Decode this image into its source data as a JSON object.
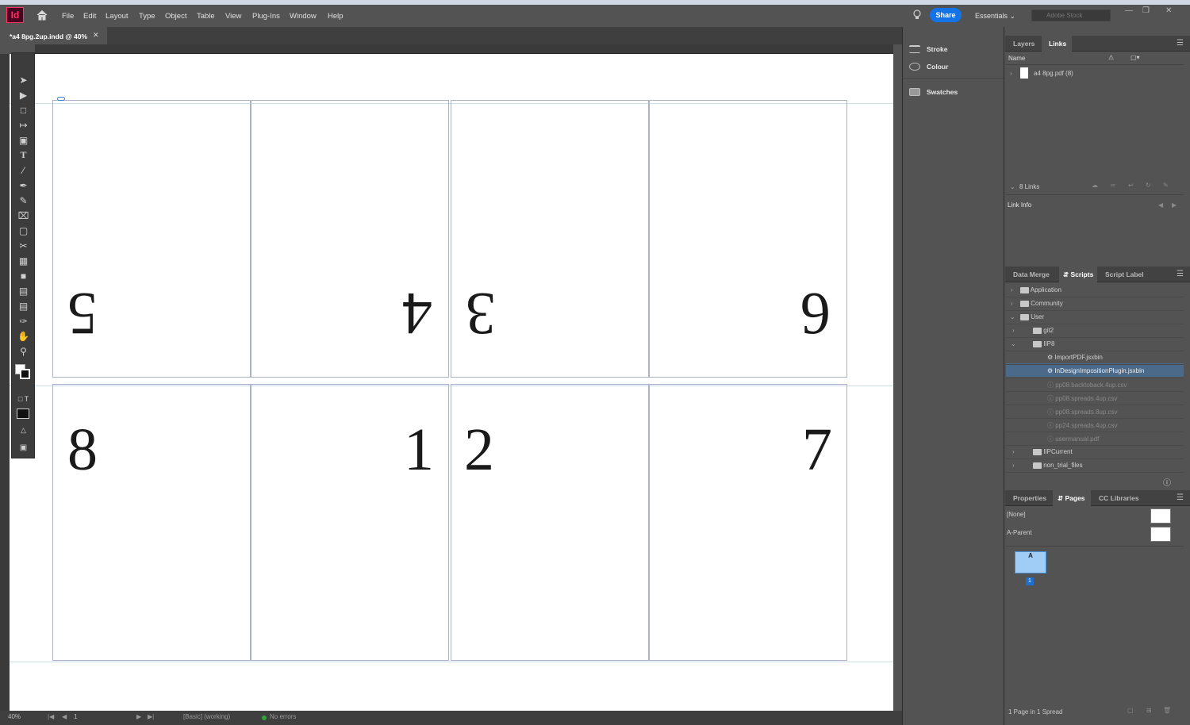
{
  "app": {
    "logo": "Id"
  },
  "menu": [
    "File",
    "Edit",
    "Layout",
    "Type",
    "Object",
    "Table",
    "View",
    "Plug-Ins",
    "Window",
    "Help"
  ],
  "header": {
    "share_label": "Share",
    "workspace_label": "Essentials",
    "stock_placeholder": "Adobe Stock"
  },
  "document": {
    "tab_title": "*a4 8pg.2up.indd @ 40%"
  },
  "pages": {
    "top_row": [
      "5",
      "4",
      "3",
      "6"
    ],
    "bottom_row": [
      "8",
      "1",
      "2",
      "7"
    ]
  },
  "status": {
    "zoom": "40%",
    "page_field": "1",
    "preflight_profile": "[Basic] (working)",
    "errors": "No errors"
  },
  "mid_panel": {
    "items": [
      "Stroke",
      "Colour",
      "Swatches"
    ]
  },
  "links_panel": {
    "tabs": [
      "Layers",
      "Links"
    ],
    "column_name": "Name",
    "link_item": "a4 8pg.pdf (8)",
    "count": "8 Links",
    "link_info_label": "Link Info"
  },
  "scripts_panel": {
    "tabs": [
      "Data Merge",
      "Scripts",
      "Script Label"
    ],
    "tree": [
      {
        "label": "Application",
        "level": 0,
        "type": "folder"
      },
      {
        "label": "Community",
        "level": 0,
        "type": "folder"
      },
      {
        "label": "User",
        "level": 0,
        "type": "folder"
      },
      {
        "label": "git2",
        "level": 1,
        "type": "folder"
      },
      {
        "label": "IIP8",
        "level": 1,
        "type": "folder"
      },
      {
        "label": "ImportPDF.jsxbin",
        "level": 2,
        "type": "script"
      },
      {
        "label": "InDesignImpositionPlugin.jsxbin",
        "level": 2,
        "type": "script",
        "selected": true
      },
      {
        "label": "pp08.backtoback.4up.csv",
        "level": 2,
        "type": "file"
      },
      {
        "label": "pp08.spreads.4up.csv",
        "level": 2,
        "type": "file"
      },
      {
        "label": "pp08.spreads.8up.csv",
        "level": 2,
        "type": "file"
      },
      {
        "label": "pp24.spreads.4up.csv",
        "level": 2,
        "type": "file"
      },
      {
        "label": "usermanual.pdf",
        "level": 2,
        "type": "file"
      },
      {
        "label": "IIPCurrent",
        "level": 1,
        "type": "folder"
      },
      {
        "label": "non_trial_files",
        "level": 1,
        "type": "folder"
      }
    ]
  },
  "pages_panel": {
    "tabs": [
      "Properties",
      "Pages",
      "CC Libraries"
    ],
    "parents": [
      "[None]",
      "A-Parent"
    ],
    "thumb_letter": "A",
    "page_number": "1",
    "footer": "1 Page in 1 Spread"
  },
  "colors": {
    "brand": "#ff3366",
    "accent": "#1473e6",
    "selection": "#4b6a8a"
  }
}
